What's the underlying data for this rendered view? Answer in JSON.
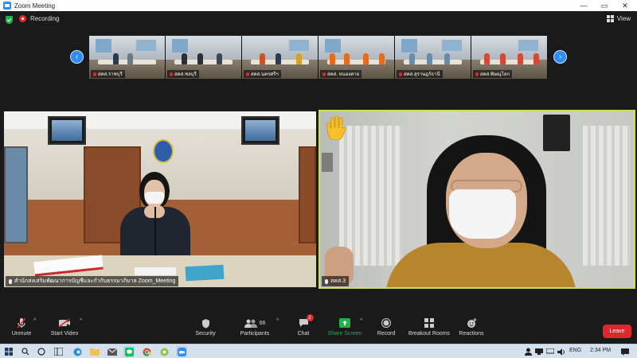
{
  "window": {
    "title": "Zoom Meeting",
    "controls": [
      "—",
      "▭",
      "✕"
    ]
  },
  "meeting": {
    "recording_label": "Recording",
    "view_label": "View"
  },
  "filmstrip": {
    "prev_icon": "‹",
    "next_icon": "›",
    "thumbnails": [
      {
        "label": "สคส.ราชบุรี"
      },
      {
        "label": "สคส.ชลบุรี"
      },
      {
        "label": "สคส.นครศรีฯ"
      },
      {
        "label": "สคส. หนองคาย"
      },
      {
        "label": "สคส.สุราษฎร์ธานี"
      },
      {
        "label": "สคส.พิษณุโลก"
      }
    ]
  },
  "main_videos": {
    "left": {
      "label": "สำนักส่งเสริมพัฒนาการบัญชีและกำกับธรรมาภิบาล Zoom_Meeting"
    },
    "right": {
      "label": "สคส.3"
    }
  },
  "toolbar": {
    "unmute": "Unmute",
    "start_video": "Start Video",
    "security": "Security",
    "participants": "Participants",
    "participants_count": "66",
    "chat": "Chat",
    "chat_badge": "2",
    "share_screen": "Share Screen",
    "record": "Record",
    "breakout_rooms": "Breakout Rooms",
    "reactions": "Reactions",
    "leave": "Leave"
  },
  "taskbar": {
    "lang": "ENG",
    "time": "2:34 PM"
  },
  "colors": {
    "accent": "#2d8cff",
    "active_speaker_border": "#c8e05a",
    "recording": "#e0272b",
    "share_green": "#23b14d",
    "leave_red": "#e0272b"
  }
}
